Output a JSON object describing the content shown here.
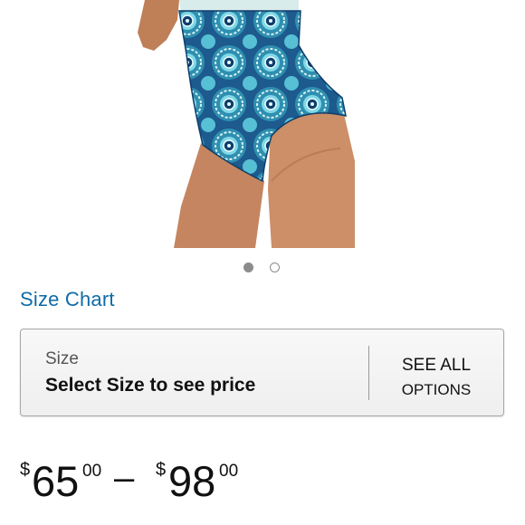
{
  "product": {
    "image": {
      "icon": "swimsuit-photo",
      "colors": {
        "background": "#ffffff",
        "skin": "#c98a61",
        "print_dark": "#1d5a8e",
        "print_light": "#7fd8e6"
      }
    },
    "carousel": {
      "count": 2,
      "active_index": 0
    }
  },
  "size_chart": {
    "label": "Size Chart"
  },
  "size_selector": {
    "label": "Size",
    "value": "Select Size to see price",
    "see_all_line1": "SEE ALL",
    "see_all_line2": "OPTIONS"
  },
  "price": {
    "currency": "$",
    "min_whole": "65",
    "min_fraction": "00",
    "separator": "–",
    "max_whole": "98",
    "max_fraction": "00"
  },
  "colors": {
    "link": "#0f6ba8",
    "text": "#111111"
  }
}
